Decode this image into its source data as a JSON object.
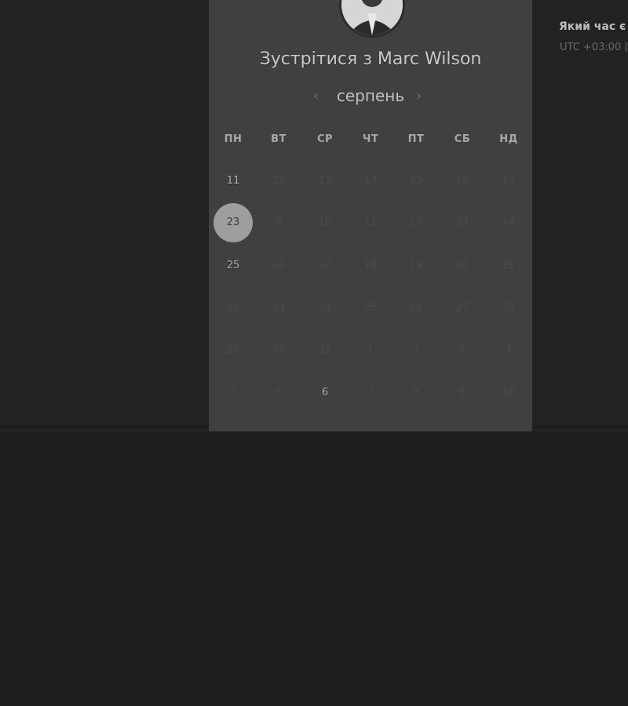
{
  "header": {
    "title": "Зустрітися з Marc Wilson"
  },
  "calendar": {
    "month": "серпень",
    "prev_icon": "chevron-left-icon",
    "next_icon": "chevron-right-icon",
    "weekdays": [
      "ПН",
      "ВТ",
      "СР",
      "ЧТ",
      "ПТ",
      "СБ",
      "НД"
    ],
    "weeks": [
      [
        {
          "d": "11",
          "s": "avail"
        },
        {
          "d": "12",
          "s": "dim"
        },
        {
          "d": "13",
          "s": "dim"
        },
        {
          "d": "14",
          "s": "dim"
        },
        {
          "d": "15",
          "s": "dim"
        },
        {
          "d": "16",
          "s": "dim"
        },
        {
          "d": "17",
          "s": "dim"
        }
      ],
      [
        {
          "d": "23",
          "s": "selected"
        },
        {
          "d": "9",
          "s": "dim"
        },
        {
          "d": "10",
          "s": "dim"
        },
        {
          "d": "11",
          "s": "dim"
        },
        {
          "d": "12",
          "s": "dim"
        },
        {
          "d": "13",
          "s": "dim"
        },
        {
          "d": "14",
          "s": "dim"
        }
      ],
      [
        {
          "d": "25",
          "s": "avail"
        },
        {
          "d": "16",
          "s": "dim"
        },
        {
          "d": "17",
          "s": "dim"
        },
        {
          "d": "18",
          "s": "dim"
        },
        {
          "d": "19",
          "s": "dim"
        },
        {
          "d": "20",
          "s": "dim"
        },
        {
          "d": "21",
          "s": "dim"
        }
      ],
      [
        {
          "d": "22",
          "s": "dim"
        },
        {
          "d": "23",
          "s": "dim"
        },
        {
          "d": "24",
          "s": "dim"
        },
        {
          "d": "25",
          "s": "dim"
        },
        {
          "d": "26",
          "s": "dim"
        },
        {
          "d": "27",
          "s": "dim"
        },
        {
          "d": "28",
          "s": "dim"
        }
      ],
      [
        {
          "d": "29",
          "s": "dim"
        },
        {
          "d": "30",
          "s": "dim"
        },
        {
          "d": "31",
          "s": "dim"
        },
        {
          "d": "1",
          "s": "dim"
        },
        {
          "d": "2",
          "s": "dim"
        },
        {
          "d": "3",
          "s": "dim"
        },
        {
          "d": "4",
          "s": "dim"
        }
      ],
      [
        {
          "d": "5",
          "s": "dim"
        },
        {
          "d": "5",
          "s": "dim"
        },
        {
          "d": "6",
          "s": "avail"
        },
        {
          "d": "7",
          "s": "dim"
        },
        {
          "d": "8",
          "s": "dim"
        },
        {
          "d": "9",
          "s": "dim"
        },
        {
          "d": "10",
          "s": "dim"
        }
      ]
    ]
  },
  "right_panel": {
    "title": "Який час є",
    "timezone": "UTC +03:00 ("
  }
}
